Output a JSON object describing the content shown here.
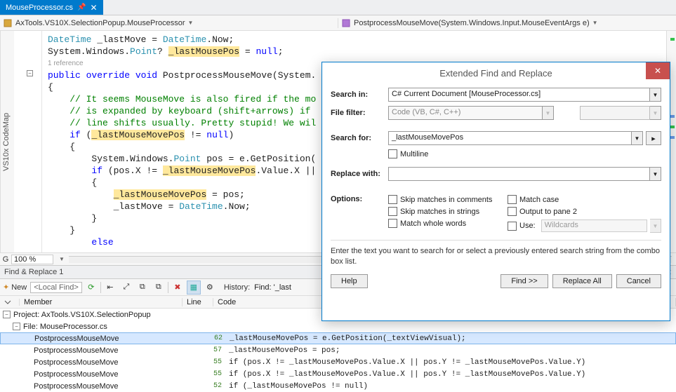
{
  "tab": {
    "title": "MouseProcessor.cs",
    "pin_icon": "pin-icon",
    "close_icon": "close-icon"
  },
  "nav": {
    "left": "AxTools.VS10X.SelectionPopup.MouseProcessor",
    "right": "PostprocessMouseMove(System.Windows.Input.MouseEventArgs e)"
  },
  "side_tab": "VS10x CodeMap",
  "ref_lens": "1 reference",
  "code": {
    "l1a": "DateTime",
    "l1b": " _lastMove = ",
    "l1c": "DateTime",
    "l1d": ".Now;",
    "l2a": "System.Windows.",
    "l2b": "Point",
    "l2c": "? ",
    "l2hl": "_lastMousePos",
    "l2d": " = ",
    "l2e": "null",
    "l2f": ";",
    "l3a": "public",
    "l3b": " ",
    "l3c": "override",
    "l3d": " ",
    "l3e": "void",
    "l3f": " PostprocessMouseMove(System.",
    "l4": "{",
    "l5": "    // It seems MouseMove is also fired if the mo",
    "l6": "    // is expanded by keyboard (shift+arrows) if ",
    "l7": "    // line shifts usually. Pretty stupid! We wil",
    "l8a": "    ",
    "l8b": "if",
    "l8c": " (",
    "l8hl": "_lastMouseMovePos",
    "l8d": " != ",
    "l8e": "null",
    "l8f": ")",
    "l9": "    {",
    "l10a": "        System.Windows.",
    "l10b": "Point",
    "l10c": " pos = e.GetPosition(",
    "l11a": "        ",
    "l11b": "if",
    "l11c": " (pos.X != ",
    "l11hl": "_lastMouseMovePos",
    "l11d": ".Value.X ||",
    "l12": "        {",
    "l13a": "            ",
    "l13hl": "_lastMouseMovePos",
    "l13b": " = pos;",
    "l14a": "            _lastMove = ",
    "l14b": "DateTime",
    "l14c": ".Now;",
    "l15": "        }",
    "l16": "    }",
    "l17": "    else"
  },
  "zoom": {
    "grip": "G",
    "value": "100 %"
  },
  "panel": {
    "title": "Find & Replace 1",
    "new": "New",
    "combo": "<Local Find>",
    "history_label": "History:",
    "history_value": "Find: '_last",
    "col_member": "Member",
    "col_line": "Line",
    "col_code": "Code",
    "project_row": "Project: AxTools.VS10X.SelectionPopup",
    "file_row": "File: MouseProcessor.cs",
    "rows": [
      {
        "member": "PostprocessMouseMove",
        "line": "62",
        "code": "_lastMouseMovePos = e.GetPosition(_textViewVisual);"
      },
      {
        "member": "PostprocessMouseMove",
        "line": "57",
        "code": "_lastMouseMovePos = pos;"
      },
      {
        "member": "PostprocessMouseMove",
        "line": "55",
        "code": "if (pos.X != _lastMouseMovePos.Value.X || pos.Y != _lastMouseMovePos.Value.Y)"
      },
      {
        "member": "PostprocessMouseMove",
        "line": "55",
        "code": "if (pos.X != _lastMouseMovePos.Value.X || pos.Y != _lastMouseMovePos.Value.Y)"
      },
      {
        "member": "PostprocessMouseMove",
        "line": "52",
        "code": "if (_lastMouseMovePos != null)"
      }
    ]
  },
  "dialog": {
    "title": "Extended Find and Replace",
    "label_search_in": "Search in:",
    "search_in_value": "C# Current Document [MouseProcessor.cs]",
    "label_file_filter": "File filter:",
    "file_filter_value": "Code (VB, C#, C++)",
    "label_search_for": "Search for:",
    "search_for_value": "_lastMouseMovePos",
    "chk_multiline": "Multiline",
    "label_replace_with": "Replace with:",
    "replace_with_value": "",
    "label_options": "Options:",
    "chk_skip_comments": "Skip matches in comments",
    "chk_skip_strings": "Skip matches in strings",
    "chk_whole_words": "Match whole words",
    "chk_match_case": "Match case",
    "chk_output_pane2": "Output to pane 2",
    "chk_use": "Use:",
    "use_combo": "Wildcards",
    "hint": "Enter the text you want to search for or select a previously entered search string from the combo box list.",
    "btn_help": "Help",
    "btn_find": "Find >>",
    "btn_replace_all": "Replace All",
    "btn_cancel": "Cancel"
  }
}
